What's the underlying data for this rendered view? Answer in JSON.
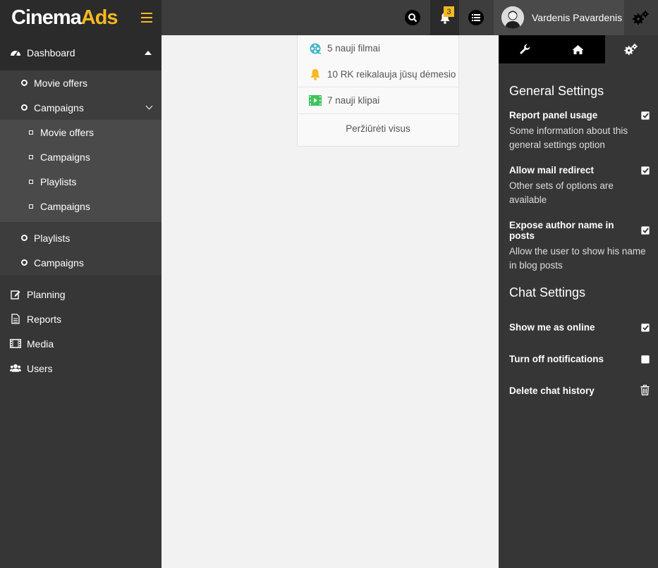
{
  "app": {
    "brand_part1": "Cinema",
    "brand_part2": "Ads"
  },
  "colors": {
    "accent": "#f5b921",
    "dark": "#2b2b2b",
    "sidebar": "#363636",
    "teal": "#3fb4c8",
    "green": "#3cc45a"
  },
  "topbar": {
    "notifications_count": "3",
    "user_name": "Vardenis Pavardenis",
    "icons": [
      "menu-icon",
      "search-icon",
      "bell-icon",
      "list-icon",
      "gears-icon"
    ]
  },
  "sidebar": {
    "dashboard": "Dashboard",
    "sub_items": [
      {
        "label": "Movie offers"
      },
      {
        "label": "Campaigns"
      }
    ],
    "subsub_items": [
      {
        "label": "Movie offers"
      },
      {
        "label": "Campaigns"
      },
      {
        "label": "Playlists"
      },
      {
        "label": "Campaigns"
      }
    ],
    "sub_items_after": [
      {
        "label": "Playlists"
      },
      {
        "label": "Campaigns"
      }
    ],
    "top_items": [
      {
        "label": "Planning",
        "icon": "edit-icon"
      },
      {
        "label": "Reports",
        "icon": "document-icon"
      },
      {
        "label": "Media",
        "icon": "film-icon"
      },
      {
        "label": "Users",
        "icon": "users-icon"
      }
    ]
  },
  "notifications": {
    "items": [
      {
        "label": "5 nauji filmai",
        "icon": "film-reel-icon"
      },
      {
        "label": "10 RK reikalauja jūsų dėmesio",
        "icon": "bell-icon"
      },
      {
        "label": "7 nauji klipai",
        "icon": "video-icon"
      }
    ],
    "view_all": "Peržiūrėti visus"
  },
  "settings_panel": {
    "tabs": [
      "wrench-icon",
      "home-icon",
      "gears-icon"
    ],
    "active_tab": 2,
    "general_title": "General Settings",
    "general": [
      {
        "label": "Report panel usage",
        "desc": "Some information about this general settings option",
        "checked": true
      },
      {
        "label": "Allow mail redirect",
        "desc": "Other sets of options are available",
        "checked": true
      },
      {
        "label": "Expose author name in posts",
        "desc": "Allow the user to show his name in blog posts",
        "checked": true
      }
    ],
    "chat_title": "Chat Settings",
    "chat": [
      {
        "label": "Show me as online",
        "control": "checkbox",
        "checked": true
      },
      {
        "label": "Turn off notifications",
        "control": "checkbox",
        "checked": false
      },
      {
        "label": "Delete chat history",
        "control": "trash"
      }
    ]
  }
}
